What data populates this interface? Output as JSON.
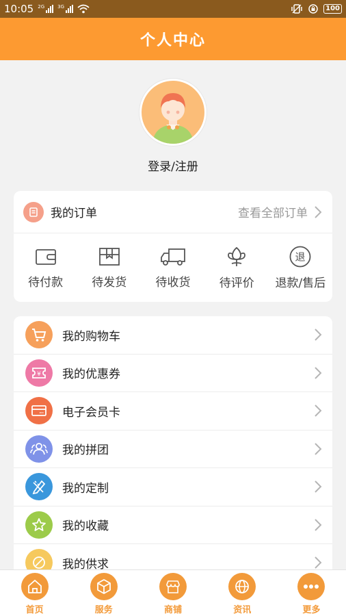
{
  "status_bar": {
    "time": "10:05",
    "sim1": "2G",
    "sim2": "3G",
    "battery": "100"
  },
  "header": {
    "title": "个人中心"
  },
  "profile": {
    "login_label": "登录/注册"
  },
  "orders": {
    "title": "我的订单",
    "view_all": "查看全部订单",
    "items": [
      {
        "label": "待付款",
        "icon": "wallet-icon"
      },
      {
        "label": "待发货",
        "icon": "box-icon"
      },
      {
        "label": "待收货",
        "icon": "truck-icon"
      },
      {
        "label": "待评价",
        "icon": "flower-icon"
      },
      {
        "label": "退款/售后",
        "icon": "refund-icon",
        "glyph": "退"
      }
    ]
  },
  "menu": {
    "items": [
      {
        "label": "我的购物车",
        "icon": "cart-icon",
        "color": "#f6a05b"
      },
      {
        "label": "我的优惠券",
        "icon": "coupon-icon",
        "color": "#ee79a6",
        "glyph": "¥"
      },
      {
        "label": "电子会员卡",
        "icon": "member-card-icon",
        "color": "#f07046"
      },
      {
        "label": "我的拼团",
        "icon": "group-icon",
        "color": "#7f92e8"
      },
      {
        "label": "我的定制",
        "icon": "custom-icon",
        "color": "#3a97dc"
      },
      {
        "label": "我的收藏",
        "icon": "star-icon",
        "color": "#9ccb4a"
      },
      {
        "label": "我的供求",
        "icon": "supply-icon",
        "color": "#f6c95e"
      }
    ]
  },
  "bottom_nav": {
    "items": [
      {
        "label": "首页",
        "icon": "home-icon"
      },
      {
        "label": "服务",
        "icon": "cube-icon"
      },
      {
        "label": "商铺",
        "icon": "shop-icon"
      },
      {
        "label": "资讯",
        "icon": "globe-icon"
      },
      {
        "label": "更多",
        "icon": "more-icon"
      }
    ]
  },
  "colors": {
    "accent": "#fd9a31",
    "nav": "#f29a3a"
  }
}
